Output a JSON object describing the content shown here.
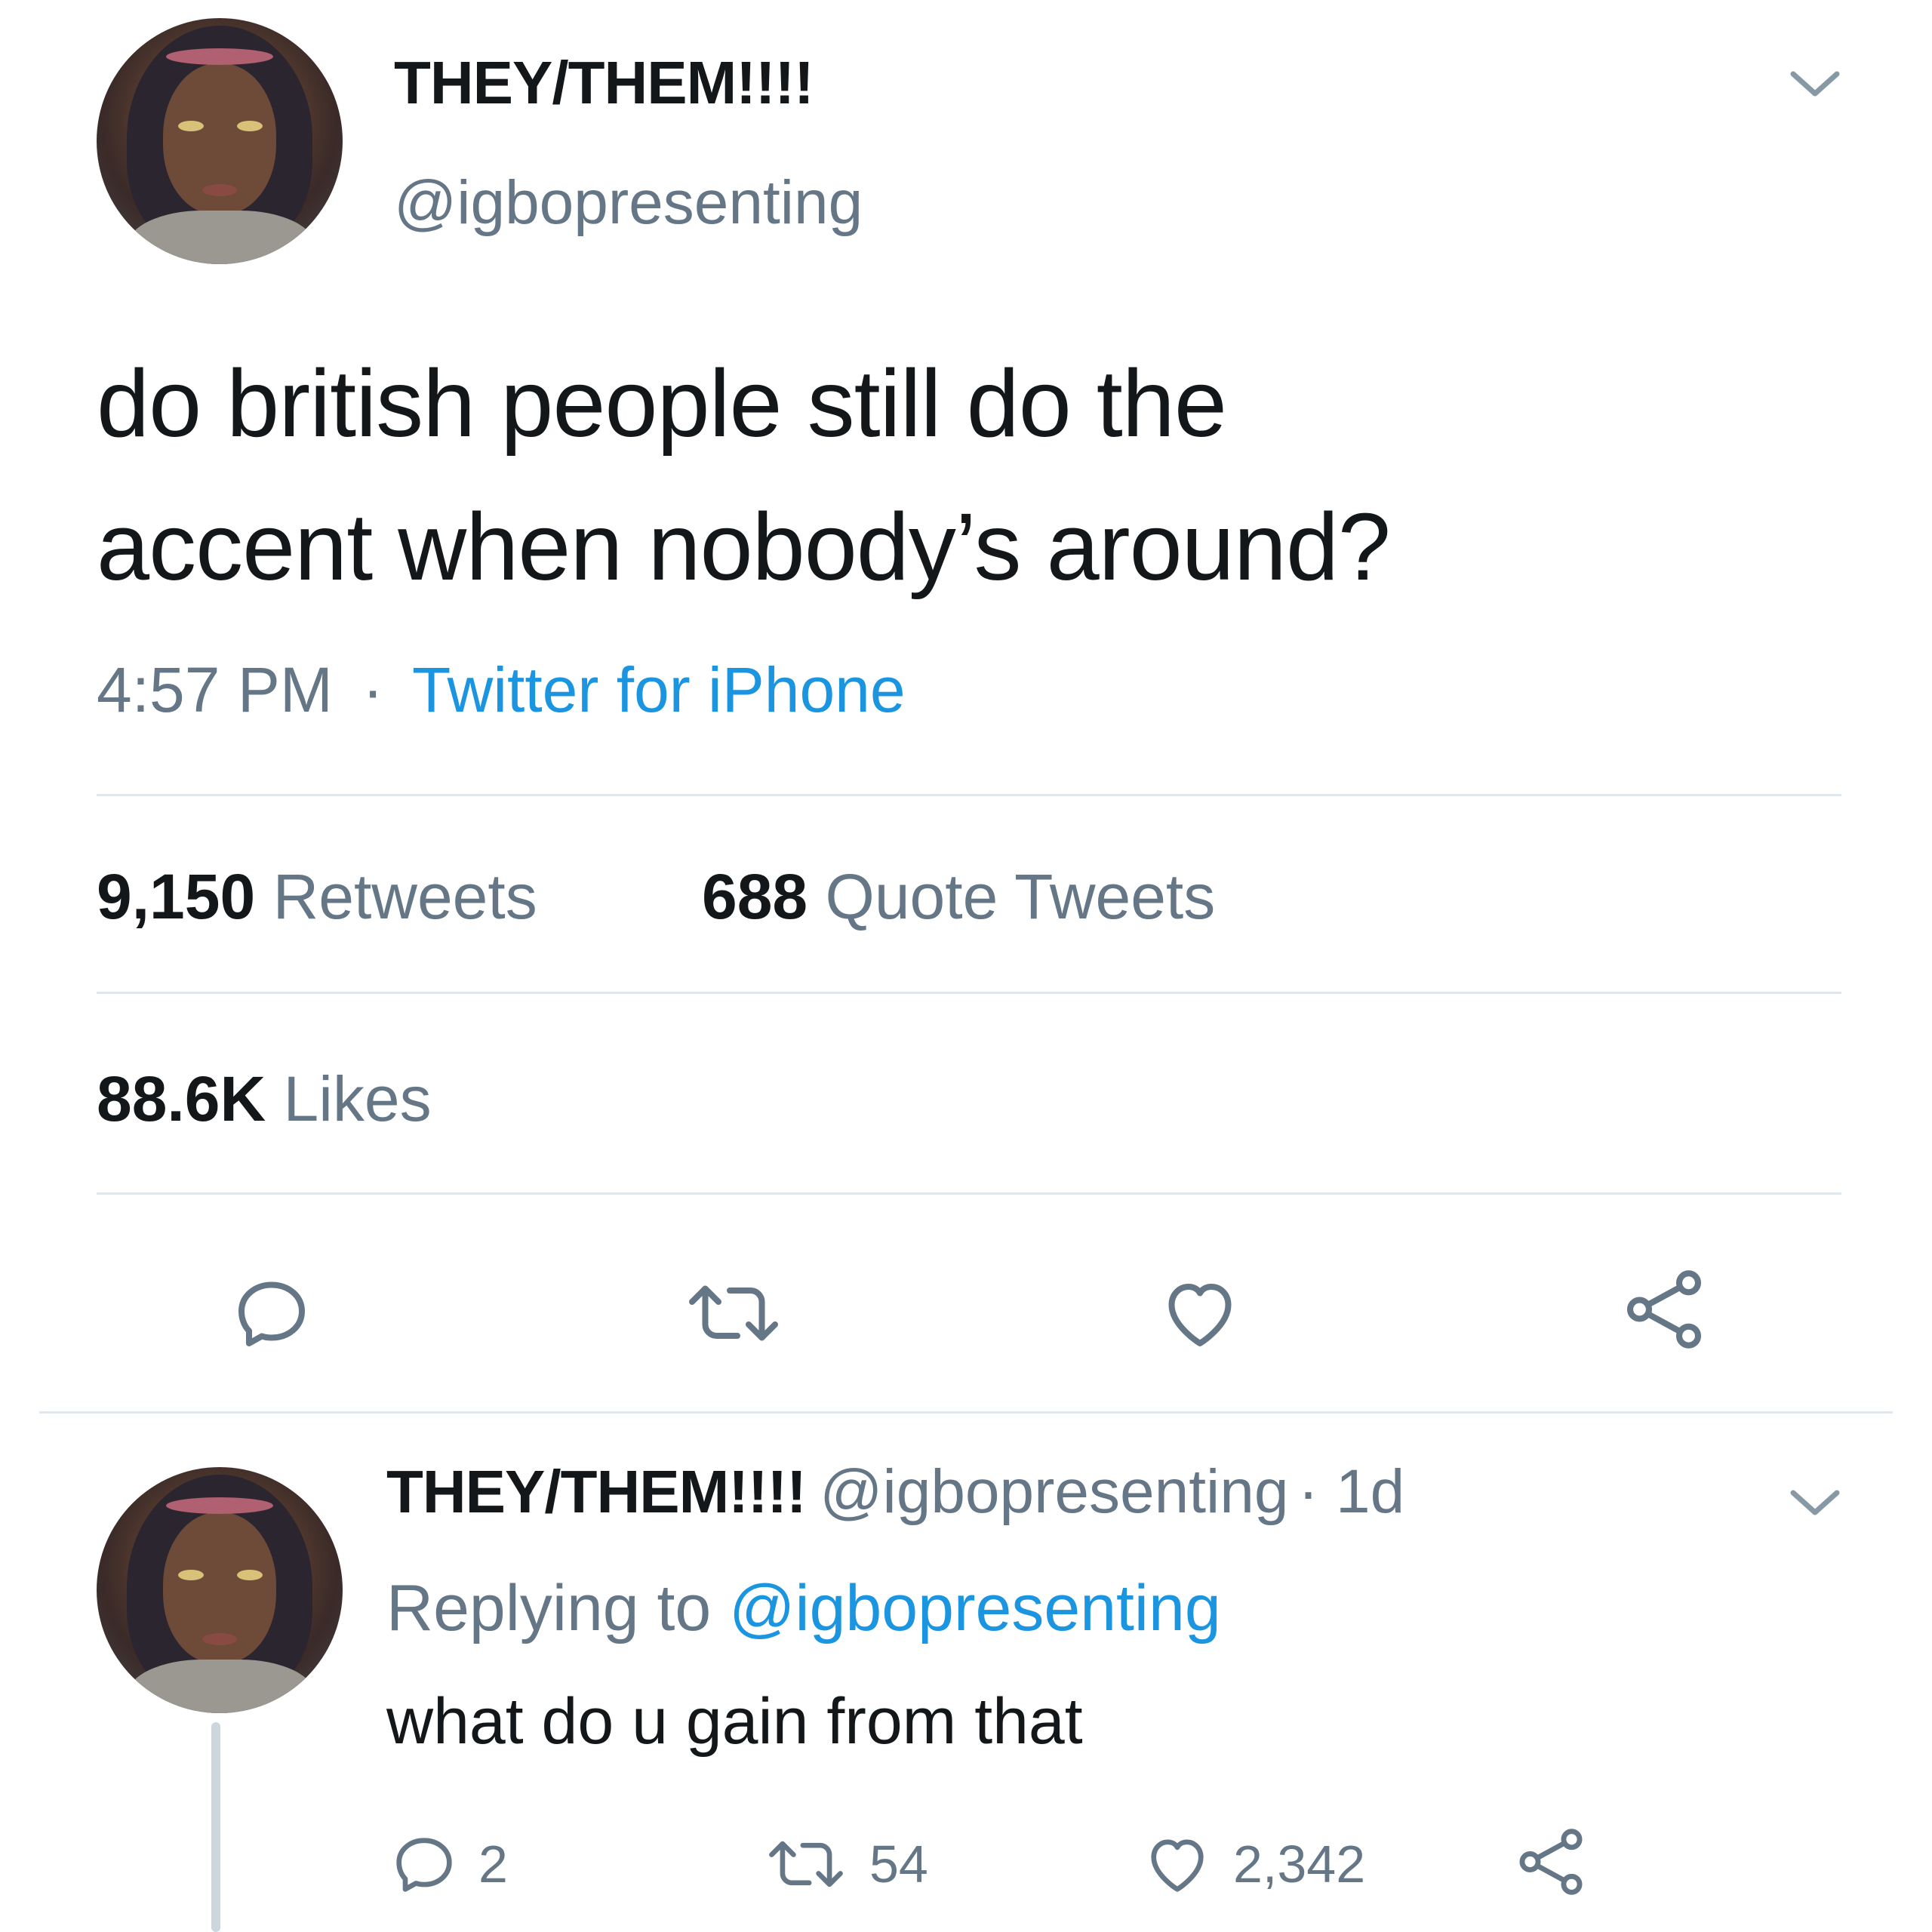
{
  "tweet": {
    "display_name": "THEY/THEM!!!!",
    "handle": "@igbopresenting",
    "text_line1": "do british people still do the",
    "text_line2": "accent when nobody’s around?",
    "time": "4:57 PM",
    "separator": "·",
    "source": "Twitter for iPhone",
    "retweets_count": "9,150",
    "retweets_label": "Retweets",
    "quotes_count": "688",
    "quotes_label": "Quote Tweets",
    "likes_count": "88.6K",
    "likes_label": "Likes"
  },
  "reply": {
    "display_name": "THEY/THEM!!!!",
    "handle": "@igbopresenting",
    "age": "· 1d",
    "replying_prefix": "Replying to",
    "replying_handle": "@igbopresenting",
    "text": "what do u gain from that",
    "reply_count": "2",
    "retweet_count": "54",
    "like_count": "2,342"
  },
  "icons": {
    "caret": "chevron-down-icon",
    "reply": "speech-bubble-icon",
    "retweet": "retweet-arrows-icon",
    "like": "heart-outline-icon",
    "share": "share-nodes-icon"
  },
  "colors": {
    "text": "#14171a",
    "muted": "#657786",
    "link": "#1b95e0",
    "divider": "#e1e8ed"
  }
}
